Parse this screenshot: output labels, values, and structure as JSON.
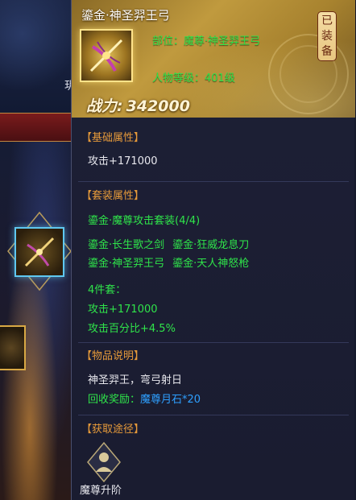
{
  "background": {
    "top_label": "玥"
  },
  "item": {
    "name": "鎏金·神圣羿王弓",
    "equipped_badge": [
      "已",
      "装",
      "备"
    ],
    "slot_label": "部位：魔尊·神圣羿王弓",
    "level_label": "人物等级：401级",
    "power_label": "战力:",
    "power_value": "342000"
  },
  "sections": {
    "base": {
      "title": "【基础属性】",
      "lines": [
        "攻击+171000"
      ]
    },
    "set": {
      "title": "【套装属性】",
      "set_name": "鎏金·魔尊攻击套装(4/4)",
      "pieces": [
        "鎏金·长生歌之剑",
        "鎏金·狂威龙息刀",
        "鎏金·神圣羿王弓",
        "鎏金·天人神怒枪"
      ],
      "bonus_title": "4件套：",
      "bonuses": [
        "攻击+171000",
        "攻击百分比+4.5%"
      ]
    },
    "desc": {
      "title": "【物品说明】",
      "text": "神圣羿王，弯弓射日",
      "reward_label": "回收奖励：",
      "reward_value": "魔尊月石*20"
    },
    "source": {
      "title": "【获取途径】",
      "label": "魔尊升阶",
      "icon": "demon-lord-ascend-icon"
    }
  },
  "colors": {
    "green": "#2fe44a",
    "orange": "#e69a3a",
    "blue": "#2ea0ff",
    "gold": "#c09a3e"
  }
}
